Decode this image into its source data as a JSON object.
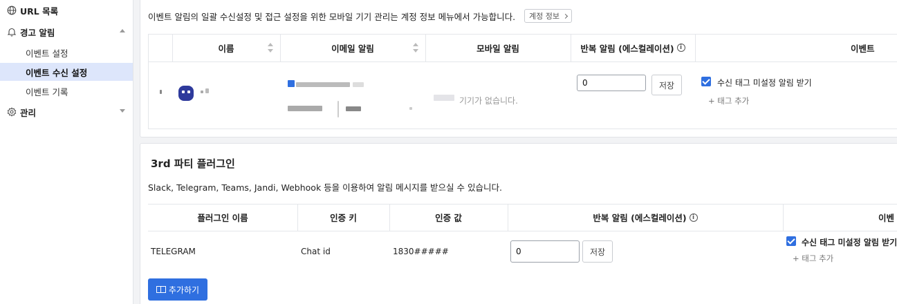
{
  "sidebar": {
    "items": [
      {
        "label": "URL 목록",
        "icon": "globe-icon"
      },
      {
        "label": "경고 알림",
        "icon": "bell-icon",
        "expanded": true
      },
      {
        "label": "이벤트 설정"
      },
      {
        "label": "이벤트 수신 설정",
        "active": true
      },
      {
        "label": "이벤트 기록"
      },
      {
        "label": "관리",
        "icon": "gear-icon",
        "expanded": false
      }
    ]
  },
  "member_section": {
    "description": "이벤트 알림의 일괄 수신설정 및 접근 설정을 위한 모바일 기기 관리는 계정 정보 메뉴에서 가능합니다.",
    "account_button": "계정 정보",
    "headers": {
      "name": "이름",
      "email": "이메일 알림",
      "mobile": "모바일 알림",
      "repeat": "반복 알림 (에스컬레이션)",
      "event": "이벤트"
    },
    "row": {
      "mobile_status": "기기가 없습니다.",
      "repeat_value": "0",
      "save_label": "저장",
      "checkbox_label": "수신 태그 미설정 알림 받기",
      "checkbox_checked": true,
      "add_tag_label": "+ 태그 추가"
    }
  },
  "plugin_section": {
    "title": "3rd 파티 플러그인",
    "description": "Slack, Telegram, Teams, Jandi, Webhook 등을 이용하여 알림 메시지를 받으실 수 있습니다.",
    "headers": {
      "plugin_name": "플러그인 이름",
      "auth_key": "인증 키",
      "auth_value": "인증 값",
      "repeat": "반복 알림 (에스컬레이션)",
      "event": "이벤"
    },
    "row": {
      "plugin_name": "TELEGRAM",
      "auth_key": "Chat id",
      "auth_value": "1830#####",
      "repeat_value": "0",
      "save_label": "저장",
      "checkbox_label": "수신 태그 미설정 알림 받기",
      "checkbox_checked": true,
      "add_tag_label": "+ 태그 추가"
    },
    "add_button": "추가하기"
  },
  "colors": {
    "primary": "#2f6fe0",
    "active_nav_bg": "#dde6fb"
  }
}
